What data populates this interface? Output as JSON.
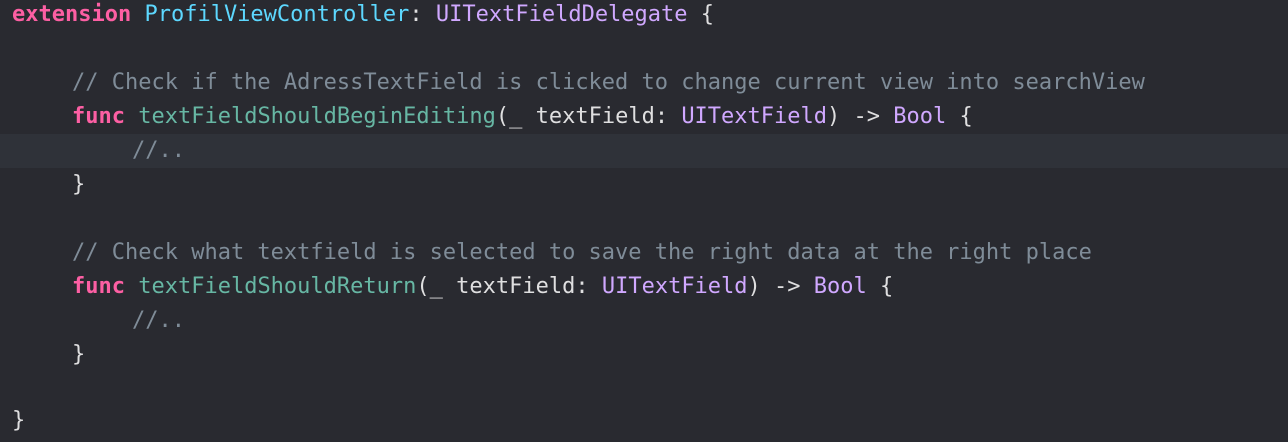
{
  "editor": {
    "line1": {
      "keyword": "extension",
      "type_name": "ProfilViewController",
      "colon": ":",
      "protocol": "UITextFieldDelegate",
      "brace": "{"
    },
    "line2": {
      "comment": "// Check if the AdressTextField is clicked to change current view into searchView"
    },
    "line3": {
      "keyword": "func",
      "name": "textFieldShouldBeginEditing",
      "open": "(_",
      "param": "textField:",
      "param_type": "UITextField",
      "close_arrow": ") ->",
      "return_type": "Bool",
      "brace": "{"
    },
    "line4": {
      "comment": "//.."
    },
    "line5": {
      "brace": "}"
    },
    "line6": {
      "comment": "// Check what textfield is selected to save the right data at the right place"
    },
    "line7": {
      "keyword": "func",
      "name": "textFieldShouldReturn",
      "open": "(_",
      "param": "textField:",
      "param_type": "UITextField",
      "close_arrow": ") ->",
      "return_type": "Bool",
      "brace": "{"
    },
    "line8": {
      "comment": "//.."
    },
    "line9": {
      "brace": "}"
    },
    "line10": {
      "brace": "}"
    },
    "colors": {
      "background": "#292a30",
      "current_line": "#2f3239",
      "keyword": "#fc5fa3",
      "type_declaration": "#5dd8ff",
      "type": "#d0a8ff",
      "function_name": "#67b7a4",
      "comment": "#7f8c98",
      "plain": "#dfdfe0"
    }
  }
}
